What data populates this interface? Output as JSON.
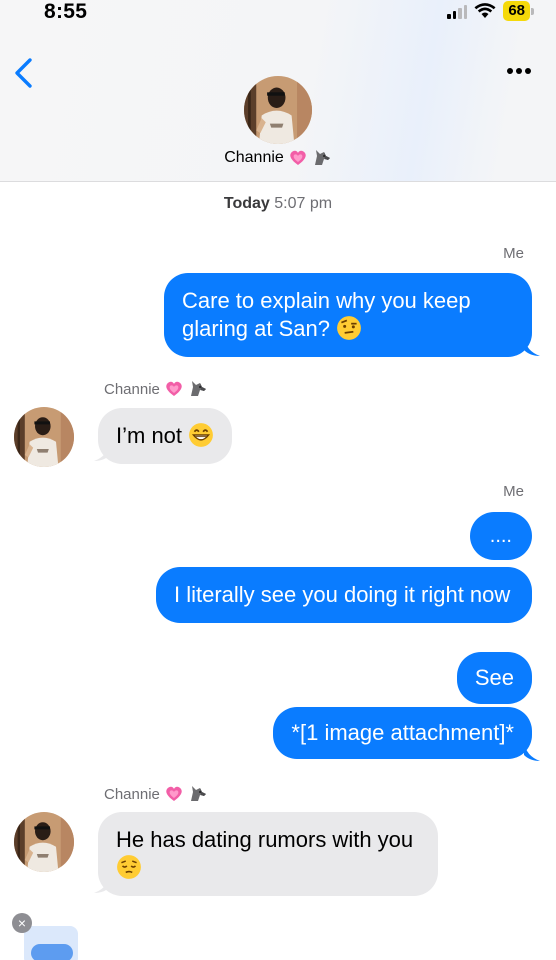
{
  "status_bar": {
    "time": "8:55",
    "battery": "68",
    "icons": [
      "cellular-signal-icon",
      "wifi-icon",
      "battery-icon"
    ]
  },
  "header": {
    "back_icon": "chevron-left-icon",
    "more_icon": "more-dots-icon",
    "contact_name": "Channie",
    "name_emojis": [
      "pink-heart-emoji",
      "wolf-emoji"
    ]
  },
  "chat": {
    "timestamp_day": "Today",
    "timestamp_time": "5:07 pm",
    "me_label": "Me",
    "them_label": "Channie",
    "messages": [
      {
        "from": "me",
        "text": "Care to explain why you keep glaring at San?",
        "emoji": "raised-eyebrow-emoji"
      },
      {
        "from": "them",
        "text": "I’m not",
        "emoji": "grinning-emoji"
      },
      {
        "from": "me",
        "text": "...."
      },
      {
        "from": "me",
        "text": "I literally see you doing it right now"
      },
      {
        "from": "me",
        "text": "See"
      },
      {
        "from": "me",
        "text": "*[1 image attachment]*"
      },
      {
        "from": "them",
        "text": "He has dating rumors with you",
        "emoji": "pensive-emoji"
      }
    ]
  },
  "attachment": {
    "remove_icon": "close-icon",
    "remove_symbol": "×"
  },
  "colors": {
    "outgoing_bubble": "#0a7cff",
    "incoming_bubble": "#e9e9eb",
    "accent": "#0a7cff",
    "battery": "#f5d90a"
  }
}
